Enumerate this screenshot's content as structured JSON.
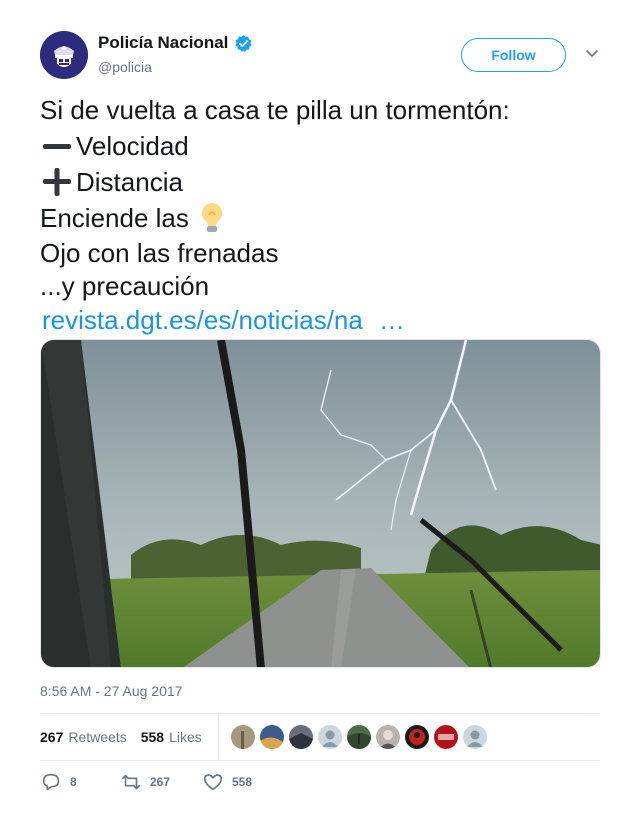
{
  "author": {
    "name": "Policía Nacional",
    "handle": "@policia",
    "verified_icon": "verified-badge-icon"
  },
  "follow_label": "Follow",
  "tweet": {
    "line1": "Si de vuelta a casa te pilla un tormentón:",
    "line2": "Velocidad",
    "line3": "Distancia",
    "line4": "Enciende las",
    "line5": "Ojo con las frenadas",
    "line6": "...y precaución",
    "link": "revista.dgt.es/es/noticias/na",
    "ellipsis": "…"
  },
  "timestamp": "8:56 AM - 27 Aug 2017",
  "stats": {
    "retweets_count": "267",
    "retweets_label": "Retweets",
    "likes_count": "558",
    "likes_label": "Likes"
  },
  "actions": {
    "replies": "8",
    "retweets": "267",
    "likes": "558"
  },
  "colors": {
    "accent": "#1da1f2",
    "link": "#1b95e0",
    "muted": "#657786"
  }
}
